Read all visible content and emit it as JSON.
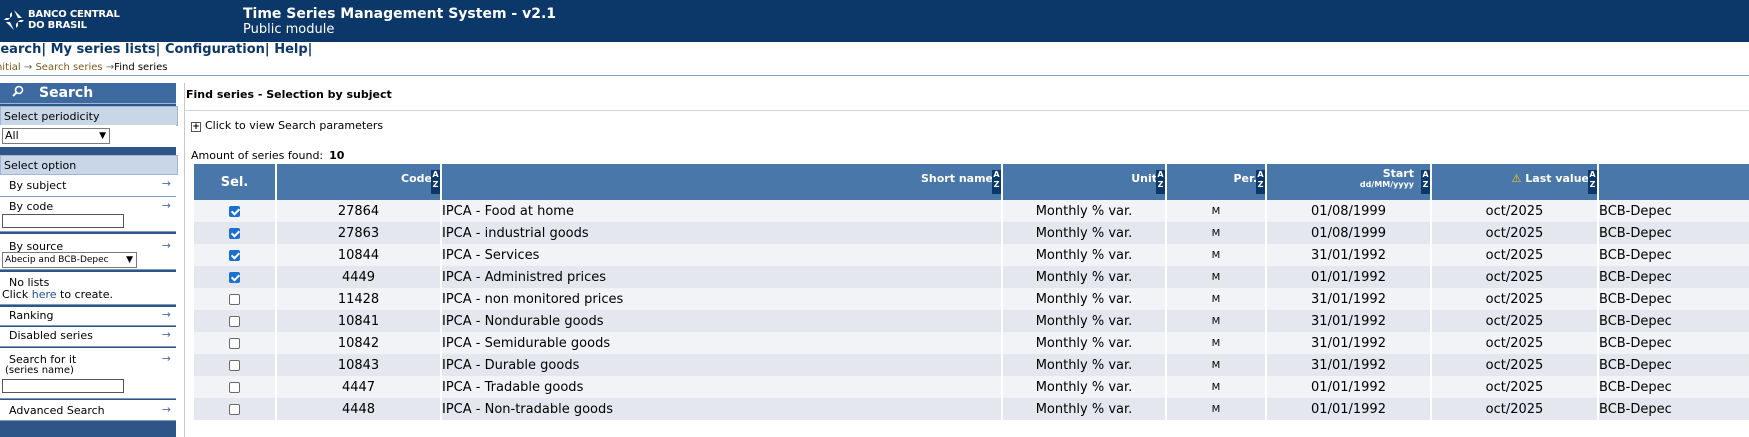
{
  "logo": {
    "line1": "BANCO CENTRAL",
    "line2": "DO BRASIL"
  },
  "header": {
    "title": "Time Series Management System - v2.1",
    "subtitle": "Public module"
  },
  "menu": {
    "search": "Search",
    "lists": "My series lists",
    "config": "Configuration",
    "help": "Help"
  },
  "breadcrumb": {
    "initial": "Initial",
    "search": "Search series",
    "current": "Find series"
  },
  "sidebar": {
    "search_title": "Search",
    "periodicity_label": "Select periodicity",
    "periodicity_value": "All",
    "option_label": "Select option",
    "by_subject": "By subject",
    "by_code": "By code",
    "by_source": "By source",
    "source_value": "Abecip and BCB-Depec",
    "no_lists": "No lists",
    "click": "Click",
    "here": "here",
    "to_create": "to create.",
    "ranking": "Ranking",
    "disabled": "Disabled series",
    "search_for_it": "Search for it",
    "series_name": "(series name)",
    "advanced": "Advanced Search"
  },
  "main": {
    "title": "Find series - Selection by subject",
    "params_link": "Click to view Search parameters",
    "amount_label": "Amount of series found:",
    "amount_value": "10"
  },
  "table": {
    "headers": {
      "sel": "Sel.",
      "code": "Code",
      "short_name": "Short name",
      "unit": "Unit",
      "per": "Per.",
      "start": "Start",
      "start_fmt": "dd/MM/yyyy",
      "last_value": "Last value"
    },
    "sort_label": "A Z",
    "rows": [
      {
        "checked": true,
        "code": "27864",
        "name": "IPCA - Food at home",
        "unit": "Monthly % var.",
        "per": "M",
        "start": "01/08/1999",
        "last": "oct/2025",
        "source": "BCB-Depec"
      },
      {
        "checked": true,
        "code": "27863",
        "name": "IPCA - industrial goods",
        "unit": "Monthly % var.",
        "per": "M",
        "start": "01/08/1999",
        "last": "oct/2025",
        "source": "BCB-Depec"
      },
      {
        "checked": true,
        "code": "10844",
        "name": "IPCA - Services",
        "unit": "Monthly % var.",
        "per": "M",
        "start": "31/01/1992",
        "last": "oct/2025",
        "source": "BCB-Depec"
      },
      {
        "checked": true,
        "code": "4449",
        "name": "IPCA - Administred prices",
        "unit": "Monthly % var.",
        "per": "M",
        "start": "01/01/1992",
        "last": "oct/2025",
        "source": "BCB-Depec"
      },
      {
        "checked": false,
        "code": "11428",
        "name": "IPCA - non monitored prices",
        "unit": "Monthly % var.",
        "per": "M",
        "start": "31/01/1992",
        "last": "oct/2025",
        "source": "BCB-Depec"
      },
      {
        "checked": false,
        "code": "10841",
        "name": "IPCA - Nondurable goods",
        "unit": "Monthly % var.",
        "per": "M",
        "start": "31/01/1992",
        "last": "oct/2025",
        "source": "BCB-Depec"
      },
      {
        "checked": false,
        "code": "10842",
        "name": "IPCA - Semidurable goods",
        "unit": "Monthly % var.",
        "per": "M",
        "start": "31/01/1992",
        "last": "oct/2025",
        "source": "BCB-Depec"
      },
      {
        "checked": false,
        "code": "10843",
        "name": "IPCA - Durable goods",
        "unit": "Monthly % var.",
        "per": "M",
        "start": "31/01/1992",
        "last": "oct/2025",
        "source": "BCB-Depec"
      },
      {
        "checked": false,
        "code": "4447",
        "name": "IPCA - Tradable goods",
        "unit": "Monthly % var.",
        "per": "M",
        "start": "01/01/1992",
        "last": "oct/2025",
        "source": "BCB-Depec"
      },
      {
        "checked": false,
        "code": "4448",
        "name": "IPCA - Non-tradable goods",
        "unit": "Monthly % var.",
        "per": "M",
        "start": "01/01/1992",
        "last": "oct/2025",
        "source": "BCB-Depec"
      }
    ]
  },
  "colors": {
    "header_bg": "#0c3869",
    "table_header": "#4a77aa",
    "sidebar": "#2d5588",
    "checkbox_on": "#1a6fd0"
  }
}
